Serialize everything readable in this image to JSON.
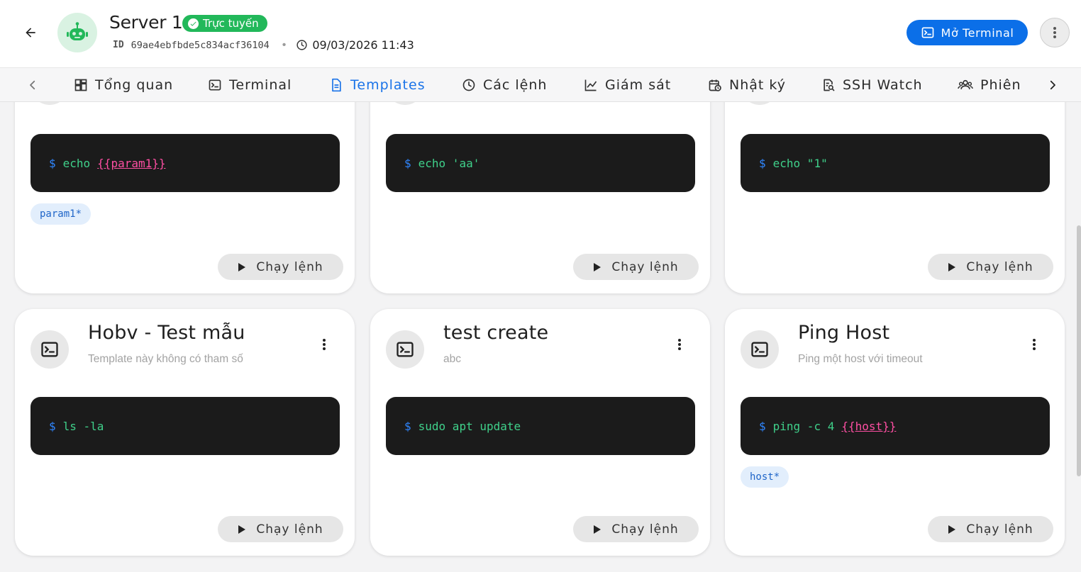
{
  "header": {
    "server_name": "Server 1",
    "status": "Trực tuyến",
    "id_label": "ID",
    "id_value": "69ae4ebfbde5c834acf36104",
    "datetime": "09/03/2026 11:43",
    "open_terminal": "Mở Terminal",
    "status_color": "#22b85a",
    "accent_color": "#0b6fe8"
  },
  "tabs": [
    {
      "label": "Tổng quan",
      "icon": "dashboard-icon"
    },
    {
      "label": "Terminal",
      "icon": "terminal-icon"
    },
    {
      "label": "Templates",
      "icon": "document-icon",
      "active": true
    },
    {
      "label": "Các lệnh",
      "icon": "clock-icon"
    },
    {
      "label": "Giám sát",
      "icon": "chart-line-icon"
    },
    {
      "label": "Nhật ký",
      "icon": "calendar-clock-icon"
    },
    {
      "label": "SSH Watch",
      "icon": "search-doc-icon"
    },
    {
      "label": "Phiên",
      "icon": "users-icon"
    }
  ],
  "cards_top": [
    {
      "prompt": "$",
      "command": "echo",
      "param": "{{param1}}",
      "chip": "param1*",
      "run": "Chạy lệnh"
    },
    {
      "prompt": "$",
      "command": "echo 'aa'",
      "param": "",
      "chip": "",
      "run": "Chạy lệnh"
    },
    {
      "prompt": "$",
      "command": "echo \"1\"",
      "param": "",
      "chip": "",
      "run": "Chạy lệnh"
    }
  ],
  "cards_bottom": [
    {
      "title": "Hobv - Test mẫu",
      "desc": "Template này không có tham số",
      "prompt": "$",
      "command": "ls -la",
      "param": "",
      "chip": "",
      "run": "Chạy lệnh"
    },
    {
      "title": "test create",
      "desc": "abc",
      "prompt": "$",
      "command": "sudo apt update",
      "param": "",
      "chip": "",
      "run": "Chạy lệnh"
    },
    {
      "title": "Ping Host",
      "desc": "Ping một host với timeout",
      "prompt": "$",
      "command": "ping -c 4",
      "param": "{{host}}",
      "chip": "host*",
      "run": "Chạy lệnh"
    }
  ]
}
